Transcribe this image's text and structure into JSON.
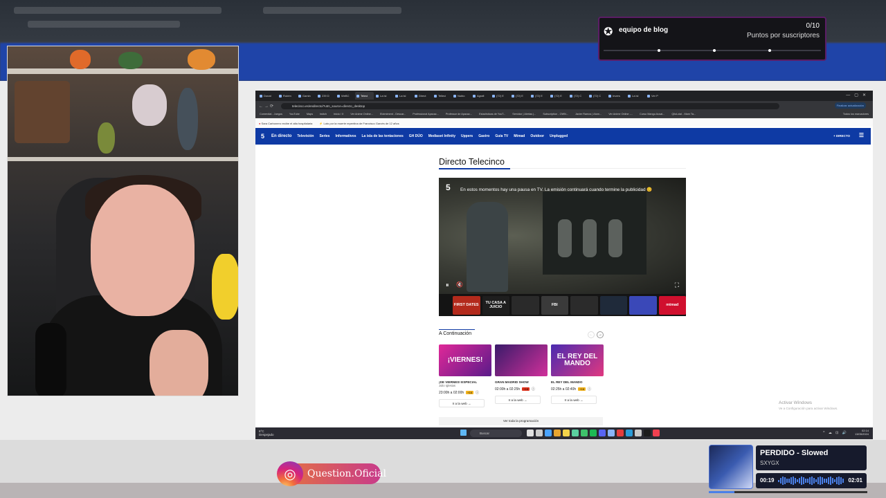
{
  "alert": {
    "title": "equipo de blog",
    "count": "0/10",
    "subtitle": "Puntos por suscriptores",
    "progress": 0
  },
  "browser": {
    "tabs": [
      "Donat",
      "Rubén",
      "Gamin",
      "239 D",
      "WeBC",
      "Teleci",
      "La isl",
      "La isl",
      "Direct",
      "Telleci",
      "Nubio",
      "Agrafi",
      "(72) E",
      "(72) E",
      "(72) E",
      "(72) E",
      "(72) C",
      "(72) C",
      "Invers",
      "La isl",
      "Ver P"
    ],
    "url": "telecinco.es/endirecto/?utm_source=directo_desktop",
    "update_button": "Finalizar actualización",
    "bookmarks": [
      "Comerdial - Juegos",
      "YouTube",
      "Maps",
      "twitch",
      "Inicio / X",
      "Ver Anime Online...",
      "Elotmiment - Descar...",
      "Professional Apacac...",
      "Professor de Apacac...",
      "Estadísticas de YouT...",
      "Servidor | Alertas |...",
      "Subscription - OWN...",
      "Javier Ramos | Atom...",
      "Ver Anime Online -...",
      "Curso Mangu Ausal...",
      "QiloLolal - Mam Ta..."
    ],
    "other_bookmarks": "Todos los marcadores",
    "news": [
      "Sara Carbonero recibe el alta hospitalaria",
      "Luto por la muerte repentina de Francisco Garcés de 12 años"
    ],
    "site_nav": {
      "logo": "5",
      "live": "En directo",
      "items": [
        "Televisión",
        "Series",
        "Informativos",
        "La isla de las tentaciones",
        "GH DÚO",
        "Mediaset Infinity",
        "Uppers",
        "Gastro",
        "Guía TV",
        "Mtmad",
        "Outdoor",
        "Unplugged"
      ],
      "right": "+ DIRECTO"
    },
    "page_title": "Directo Telecinco",
    "player": {
      "channel_logo": "5",
      "message": "En estos momentos hay una pausa en TV. La emisión continuará cuando termine la publicidad 😊",
      "thumbs": [
        "FIRST DATES",
        "TU CASA A JUICIO",
        "",
        "FBI",
        "",
        "",
        "",
        "mtmad"
      ]
    },
    "next_title": "A Continuación",
    "cards": [
      {
        "image_text": "¡VIERNES!",
        "name": "¡De viernes! Especial",
        "host": "Julio Iglesias",
        "time": "23:00h a 02:00h",
        "rating": "+16",
        "rating_color": "#f2b31c"
      },
      {
        "image_text": "",
        "name": "Gran Madrid Show",
        "host": "",
        "time": "02:00h a 02:25h",
        "rating": "+18",
        "rating_color": "#e0321c"
      },
      {
        "image_text": "EL REY DEL MANDO",
        "name": "El rey del mando",
        "host": "",
        "time": "02:25h a 02:40h",
        "rating": "+16",
        "rating_color": "#f2b31c"
      }
    ],
    "card_button": "Ir a la web →",
    "all_programming": "Ver toda la programación",
    "watermark": "Activar Windows",
    "watermark_sub": "Ve a Configuración para activar Windows.",
    "taskbar": {
      "weather_temp": "6°C",
      "weather_desc": "Despejado",
      "search": "Buscar",
      "time": "02:14",
      "date": "13/05/2024",
      "icon_colors": [
        "#e0e0e0",
        "#ccc",
        "#4aa3ff",
        "#e8a530",
        "#f3d34a",
        "#5ad0a0",
        "#3ec16b",
        "#1db954",
        "#5865f2",
        "#8ab4f8",
        "#e43d3d",
        "#2b9bd8",
        "#c9c9c9",
        "#1c1c1c",
        "#f04050"
      ]
    }
  },
  "instagram": {
    "handle": "Question.Oficial"
  },
  "music": {
    "song": "PERDIDO - Slowed",
    "artist": "SXYGX",
    "elapsed": "00:19",
    "total": "02:01",
    "progress": 0.16
  }
}
